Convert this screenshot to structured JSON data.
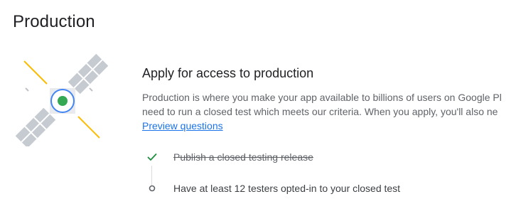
{
  "page": {
    "title": "Production"
  },
  "illustration": {
    "icon": "satellite-icon",
    "colors": {
      "panel": "#b9bfc6",
      "body_ring": "#4285f4",
      "core": "#34a853",
      "beam": "#fbbc04"
    }
  },
  "apply": {
    "title": "Apply for access to production",
    "description_lines": [
      "Production is where you make your app available to billions of users on Google Pl",
      "need to run a closed test which meets our criteria. When you apply, you'll also ne"
    ],
    "preview_link": "Preview questions"
  },
  "steps": [
    {
      "label": "Publish a closed testing release",
      "status": "complete",
      "icon": "check-icon"
    },
    {
      "label": "Have at least 12 testers opted-in to your closed test",
      "status": "pending",
      "icon": "circle-icon"
    }
  ],
  "colors": {
    "link": "#1a73e8",
    "check": "#1e8e3e",
    "text": "#202124",
    "muted": "#5f6368"
  }
}
